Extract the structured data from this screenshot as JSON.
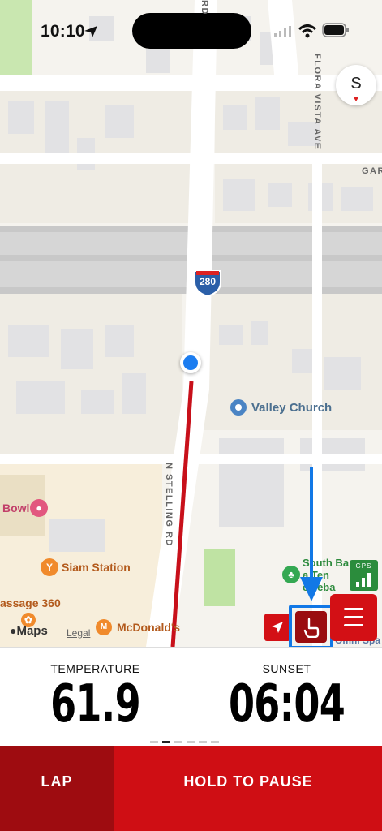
{
  "status_bar": {
    "time": "10:10"
  },
  "map": {
    "compass_letter": "S",
    "highway_shield": "280",
    "roads": {
      "n_stelling": "N STELLING RD",
      "flora_vista": "FLORA VISTA AVE",
      "gar": "GAR",
      "rd_top": "RD"
    },
    "pois": {
      "valley_church": "Valley Church",
      "bowl": "Bowl",
      "siam_station": "Siam Station",
      "massage": "assage 360",
      "mcdonalds": "McDonald's",
      "south_bay_1": "South Ba",
      "south_bay_2": "a Ten",
      "south_bay_3": "ckleba",
      "omni_spa": "Omni Spa"
    },
    "maps_logo": "Maps",
    "legal": "Legal",
    "gps_label": "GPS"
  },
  "stats": [
    {
      "label": "TEMPERATURE",
      "value": "61.9"
    },
    {
      "label": "SUNSET",
      "value": "06:04"
    }
  ],
  "pager": {
    "count": 6,
    "active_index": 1
  },
  "bottom": {
    "lap_label": "LAP",
    "pause_label": "HOLD TO PAUSE"
  },
  "colors": {
    "accent_red": "#cf0e14",
    "dark_red": "#9e0c10",
    "highlight_blue": "#1278e6",
    "user_dot": "#1c7df0",
    "route": "#c8101a"
  }
}
